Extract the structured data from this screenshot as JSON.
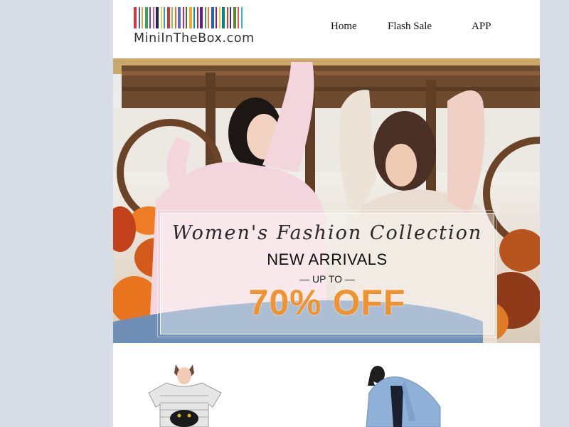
{
  "brand": {
    "name": "MiniInTheBox.com",
    "barcode_colors": [
      "#d8343b",
      "#2f6fb8",
      "#f2a33a",
      "#3aa356",
      "#7b3fa0",
      "#e65d8f",
      "#1b2a49",
      "#f4d03f",
      "#26a5c9",
      "#d8343b",
      "#8bc34a",
      "#ef6c2b",
      "#5c6bc0",
      "#e91e63",
      "#2e7d32",
      "#f9a825",
      "#0097a7",
      "#c62828",
      "#6a1b9a",
      "#43a047",
      "#ff7043",
      "#1565c0",
      "#ad1457",
      "#fbc02d",
      "#00838f",
      "#d84315",
      "#4527a0",
      "#558b2f",
      "#ef5350",
      "#29b6f6"
    ]
  },
  "nav": {
    "home": "Home",
    "flash_sale": "Flash Sale",
    "app": "APP"
  },
  "hero": {
    "script_title": "Women's Fashion Collection",
    "headline": "NEW ARRIVALS",
    "up_to": "— UP TO —",
    "discount": "70% OFF",
    "accent_color": "#f0922f"
  }
}
